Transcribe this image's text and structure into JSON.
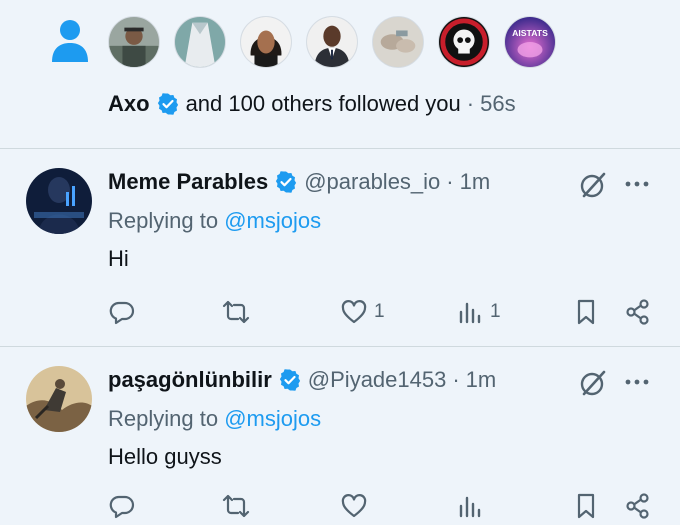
{
  "notification": {
    "actor": "Axo",
    "text": "and 100 others followed you",
    "separator": "·",
    "time": "56s",
    "avatars": [
      "avatar-man-cap",
      "avatar-shirt",
      "avatar-woman",
      "avatar-man-suit",
      "avatar-hands",
      "avatar-skull",
      "avatar-aistats"
    ],
    "avatar_label_aistats": "AISTATS"
  },
  "tweets": [
    {
      "display_name": "Meme Parables",
      "handle": "@parables_io",
      "separator": "·",
      "time": "1m",
      "replying_prefix": "Replying to",
      "replying_to": "@msjojos",
      "text": "Hi",
      "likes": "1",
      "views": "1"
    },
    {
      "display_name": "paşagönlünbilir",
      "handle": "@Piyade1453",
      "separator": "·",
      "time": "1m",
      "replying_prefix": "Replying to",
      "replying_to": "@msjojos",
      "text": "Hello guyss",
      "likes": "",
      "views": ""
    }
  ],
  "colors": {
    "background": "#eef4fa",
    "accent": "#1d9bf0",
    "muted": "#536471",
    "text": "#0f1419"
  }
}
